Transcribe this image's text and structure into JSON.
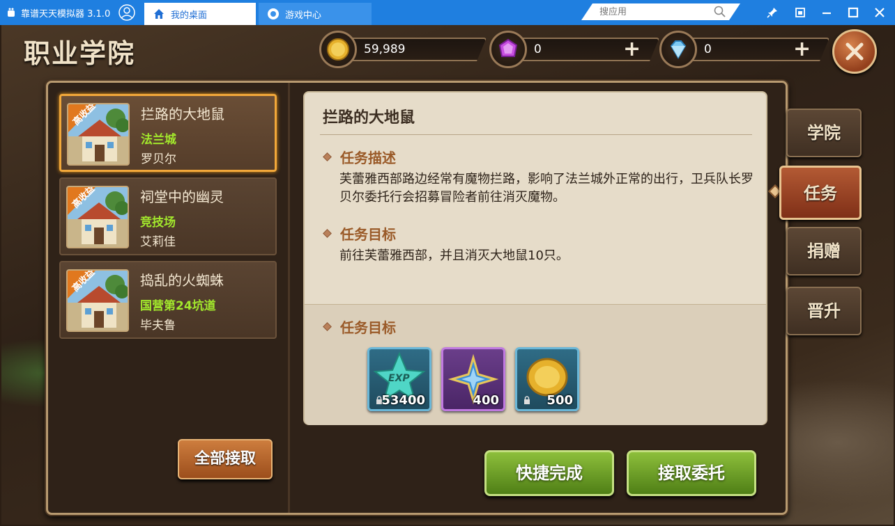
{
  "emulator": {
    "app_title": "靠谱天天模拟器 3.1.0",
    "tabs": [
      {
        "label": "我的桌面",
        "icon": "home-icon"
      },
      {
        "label": "游戏中心",
        "icon": "gamepad-icon"
      }
    ],
    "search_placeholder": "搜应用",
    "window_buttons": [
      "pin-icon",
      "restore-icon",
      "minimize-icon",
      "maximize-icon",
      "close-icon"
    ],
    "colors": {
      "titlebar": "#1f7fe0",
      "active_tab_bg": "#ffffff"
    }
  },
  "page": {
    "title": "职业学院"
  },
  "resources": {
    "gold": {
      "value": "59,989",
      "icon": "gold-coin-icon"
    },
    "crystal": {
      "value": "0",
      "icon": "purple-crystal-icon",
      "add": "+"
    },
    "diamond": {
      "value": "0",
      "icon": "diamond-icon",
      "add": "+"
    }
  },
  "quests": [
    {
      "tag": "高收益",
      "name": "拦路的大地鼠",
      "place": "法兰城",
      "npc": "罗贝尔",
      "selected": true
    },
    {
      "tag": "高收益",
      "name": "祠堂中的幽灵",
      "place": "竞技场",
      "npc": "艾莉佳",
      "selected": false
    },
    {
      "tag": "高收益",
      "name": "捣乱的火蜘蛛",
      "place": "国营第24坑道",
      "npc": "毕夫鲁",
      "selected": false
    }
  ],
  "accept_all_label": "全部接取",
  "detail": {
    "title": "拦路的大地鼠",
    "desc_heading": "任务描述",
    "desc_text": "芙蕾雅西部路边经常有魔物拦路，影响了法兰城外正常的出行，卫兵队长罗贝尔委托行会招募冒险者前往消灭魔物。",
    "goal_heading": "任务目标",
    "goal_text": "前往芙蕾雅西部，并且消灭大地鼠10只。",
    "reward_heading": "任务目标",
    "rewards": [
      {
        "icon": "exp-star-icon",
        "count": "53400",
        "locked": true
      },
      {
        "icon": "blue-cross-item-icon",
        "count": "400",
        "locked": false
      },
      {
        "icon": "gold-coin-icon",
        "count": "500",
        "locked": true
      }
    ]
  },
  "buttons": {
    "quick_complete": "快捷完成",
    "accept": "接取委托"
  },
  "side_tabs": [
    {
      "label": "学院",
      "active": false
    },
    {
      "label": "任务",
      "active": true
    },
    {
      "label": "捐赠",
      "active": false
    },
    {
      "label": "晋升",
      "active": false
    }
  ],
  "accent_colors": {
    "gold_highlight": "#f2a83a",
    "place_green": "#a2e82c",
    "active_tab": "#b35a34"
  }
}
